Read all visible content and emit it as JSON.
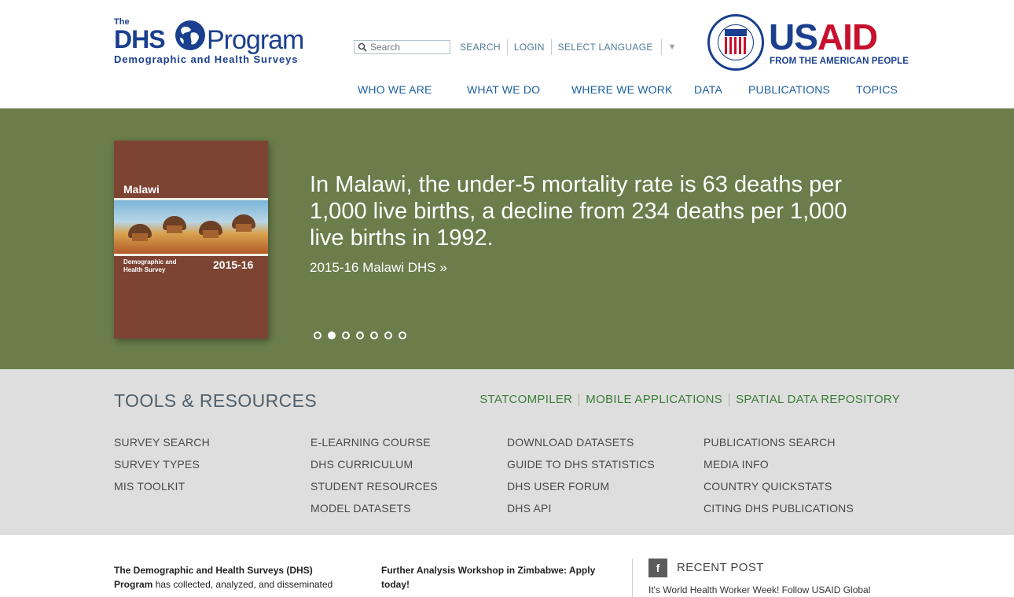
{
  "brand": {
    "logo_the": "The",
    "logo_dhs": "DHS",
    "logo_program": "Program",
    "logo_tagline": "Demographic and Health Surveys",
    "primary_color": "#1b3f8f"
  },
  "search": {
    "placeholder": "Search"
  },
  "utility": {
    "search": "SEARCH",
    "login": "LOGIN",
    "language": "SELECT LANGUAGE",
    "language_arrow": "▼"
  },
  "usaid": {
    "us": "US",
    "aid": "AID",
    "tagline": "FROM THE AMERICAN PEOPLE"
  },
  "nav": {
    "items": [
      "WHO WE ARE",
      "WHAT WE DO",
      "WHERE WE WORK",
      "DATA",
      "PUBLICATIONS",
      "TOPICS"
    ]
  },
  "hero": {
    "cover": {
      "country": "Malawi",
      "subtitle_line1": "Demographic and",
      "subtitle_line2": "Health Survey",
      "year": "2015-16"
    },
    "headline": "In Malawi, the under-5 mortality rate is 63 deaths per 1,000 live births, a decline from 234 deaths per 1,000 live births in 1992.",
    "link": "2015-16 Malawi DHS »",
    "slide_count": 7,
    "active_slide": 2,
    "background": "#6a7d4b"
  },
  "tools": {
    "title": "TOOLS & RESOURCES",
    "top_links": [
      "STATCOMPILER",
      "MOBILE APPLICATIONS",
      "SPATIAL DATA REPOSITORY"
    ],
    "col1": [
      "SURVEY SEARCH",
      "SURVEY TYPES",
      "MIS TOOLKIT"
    ],
    "col2": [
      "E-LEARNING COURSE",
      "DHS CURRICULUM",
      "STUDENT RESOURCES",
      "MODEL DATASETS"
    ],
    "col3": [
      "DOWNLOAD DATASETS",
      "GUIDE TO DHS STATISTICS",
      "DHS USER FORUM",
      "DHS API"
    ],
    "col4": [
      "PUBLICATIONS SEARCH",
      "MEDIA INFO",
      "COUNTRY QUICKSTATS",
      "CITING DHS PUBLICATIONS"
    ]
  },
  "about": {
    "bold_line1": "The Demographic and Health Surveys (DHS)",
    "bold_line2": "Program",
    "text": " has collected, analyzed, and disseminated"
  },
  "news": {
    "title_line1": "Further Analysis Workshop in Zimbabwe: Apply",
    "title_line2": "today!"
  },
  "recent": {
    "icon": "f",
    "title": "RECENT POST",
    "text": "It's World Health Worker Week! Follow USAID Global"
  }
}
